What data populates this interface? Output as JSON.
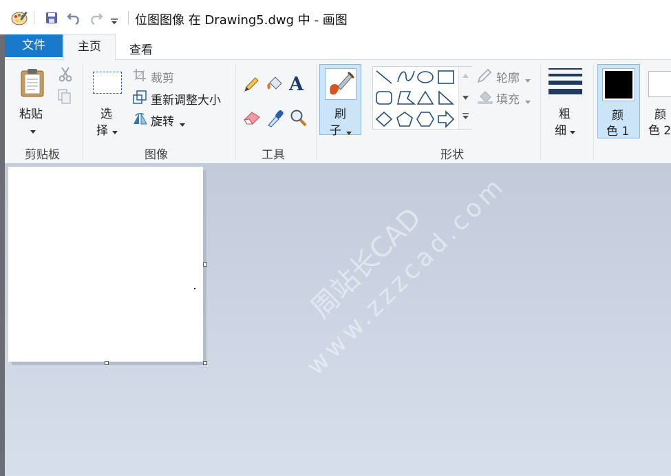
{
  "window": {
    "title": "位图图像 在 Drawing5.dwg 中 - 画图"
  },
  "tabs": {
    "file": "文件",
    "home": "主页",
    "view": "查看"
  },
  "clipboard": {
    "paste_line1": "粘贴",
    "group": "剪贴板"
  },
  "image": {
    "select_line1": "选",
    "select_line2": "择",
    "crop": "裁剪",
    "resize": "重新调整大小",
    "rotate": "旋转",
    "group": "图像"
  },
  "tools": {
    "group": "工具"
  },
  "brushes": {
    "line1": "刷",
    "line2": "子"
  },
  "shapes": {
    "outline": "轮廓",
    "fill": "填充",
    "group": "形状"
  },
  "size": {
    "line1": "粗",
    "line2": "细"
  },
  "color1": {
    "line1": "颜",
    "line2": "色 1"
  },
  "color2": {
    "line1": "颜",
    "line2": "色 2"
  },
  "colors": {
    "ribbon_bg": "#f5f6f7",
    "file_tab": "#1979ca",
    "selected": "#cce4f7",
    "workspace": "#c8d1e0",
    "color1_value": "#000000"
  },
  "watermark": {
    "line1": "周站长CAD",
    "line2": "www.zzzcad.com"
  }
}
